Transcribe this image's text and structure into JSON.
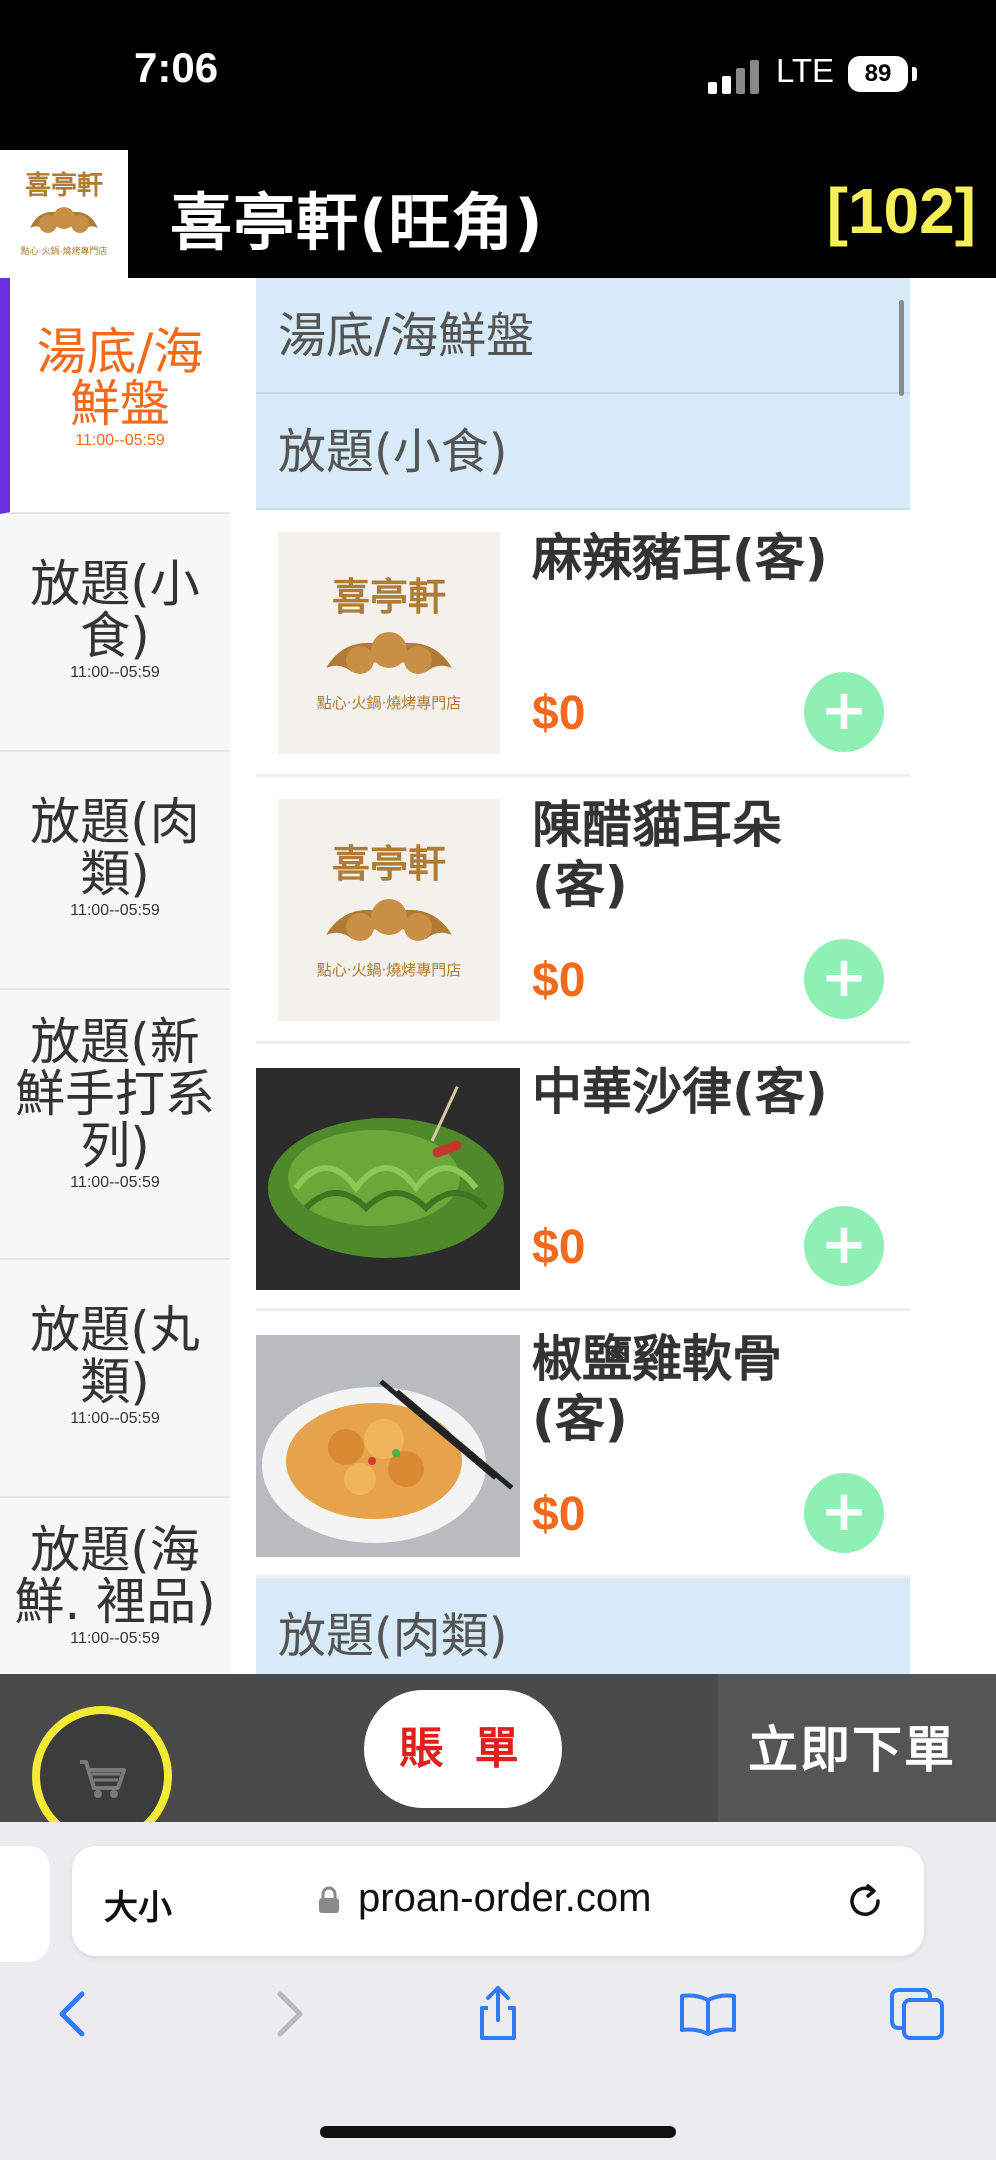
{
  "status_bar": {
    "time": "7:06",
    "network": "LTE",
    "battery": "89"
  },
  "header": {
    "logo_text": "喜亭軒",
    "logo_subtitle": "點心‧火鍋‧燒烤專門店",
    "title": "喜亭軒(旺角)",
    "table_number": "[102]"
  },
  "categories": [
    {
      "name": "湯底/海鮮盤",
      "time": "11:00--05:59",
      "active": true
    },
    {
      "name": "放題(小食)",
      "time": "11:00--05:59"
    },
    {
      "name": "放題(肉類)",
      "time": "11:00--05:59"
    },
    {
      "name": "放題(新鮮手打系列)",
      "time": "11:00--05:59"
    },
    {
      "name": "放題(丸類)",
      "time": "11:00--05:59"
    },
    {
      "name": "放題(海鮮. 裡品)",
      "time": "11:00--05:59"
    }
  ],
  "sections": [
    {
      "title": "湯底/海鮮盤"
    },
    {
      "title": "放題(小食)"
    },
    {
      "title": "放題(肉類)"
    }
  ],
  "items": [
    {
      "name": "麻辣豬耳(客)",
      "price": "$0",
      "image": "logo-placeholder",
      "add": "+"
    },
    {
      "name": "陳醋貓耳朵(客)",
      "price": "$0",
      "image": "logo-placeholder",
      "add": "+"
    },
    {
      "name": "中華沙律(客)",
      "price": "$0",
      "image": "seaweed-salad-photo",
      "add": "+"
    },
    {
      "name": "椒鹽雞軟骨(客)",
      "price": "$0",
      "image": "fried-chicken-cartilage-photo",
      "add": "+"
    }
  ],
  "actions": {
    "bill": "賬 單",
    "order_now": "立即下單",
    "cart_icon": "cart-icon"
  },
  "browser": {
    "text_size": "大小",
    "url": "proan-order.com"
  },
  "colors": {
    "accent_orange": "#f36a1c",
    "active_bar": "#6a2fe0",
    "section_bg": "#d6eaf8",
    "add_green": "#8ef0b4",
    "table_yellow": "#f5f05a",
    "cart_ring": "#f2ea34",
    "bill_red": "#e0201c"
  }
}
